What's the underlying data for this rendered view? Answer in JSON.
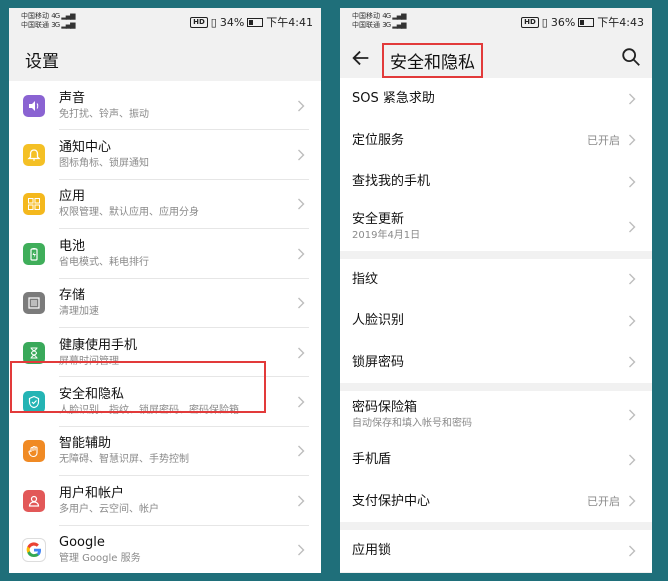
{
  "left": {
    "status": {
      "carrier1": "中国移动",
      "carrier2": "中国联通",
      "net1": "4G",
      "net2": "3G",
      "hd": "HD",
      "battery": "34%",
      "time": "下午4:41"
    },
    "title": "设置",
    "items": [
      {
        "title": "声音",
        "sub": "免打扰、铃声、振动",
        "icon": "sound-icon",
        "color": "#8a63d2"
      },
      {
        "title": "通知中心",
        "sub": "图标角标、锁屏通知",
        "icon": "bell-icon",
        "color": "#f4c025"
      },
      {
        "title": "应用",
        "sub": "权限管理、默认应用、应用分身",
        "icon": "apps-grid-icon",
        "color": "#f4b81d"
      },
      {
        "title": "电池",
        "sub": "省电模式、耗电排行",
        "icon": "battery-icon",
        "color": "#3fae5a"
      },
      {
        "title": "存储",
        "sub": "清理加速",
        "icon": "storage-icon",
        "color": "#7b7b7b"
      },
      {
        "title": "健康使用手机",
        "sub": "屏幕时间管理",
        "icon": "hourglass-icon",
        "color": "#39a95a"
      },
      {
        "title": "安全和隐私",
        "sub": "人脸识别、指纹、锁屏密码、密码保险箱",
        "icon": "shield-icon",
        "color": "#24b4b4"
      },
      {
        "title": "智能辅助",
        "sub": "无障碍、智慧识屏、手势控制",
        "icon": "hand-icon",
        "color": "#f08a24"
      },
      {
        "title": "用户和帐户",
        "sub": "多用户、云空间、帐户",
        "icon": "user-icon",
        "color": "#e25858"
      },
      {
        "title": "Google",
        "sub": "管理 Google 服务",
        "icon": "google-icon",
        "color": "#ffffff"
      }
    ]
  },
  "right": {
    "status": {
      "carrier1": "中国移动",
      "carrier2": "中国联通",
      "net1": "4G",
      "net2": "3G",
      "hd": "HD",
      "battery": "36%",
      "time": "下午4:43"
    },
    "title": "安全和隐私",
    "groups": [
      [
        {
          "title": "SOS 紧急求助",
          "sub": "",
          "value": ""
        },
        {
          "title": "定位服务",
          "sub": "",
          "value": "已开启"
        },
        {
          "title": "查找我的手机",
          "sub": "",
          "value": ""
        },
        {
          "title": "安全更新",
          "sub": "2019年4月1日",
          "value": ""
        }
      ],
      [
        {
          "title": "指纹",
          "sub": "",
          "value": ""
        },
        {
          "title": "人脸识别",
          "sub": "",
          "value": ""
        },
        {
          "title": "锁屏密码",
          "sub": "",
          "value": ""
        }
      ],
      [
        {
          "title": "密码保险箱",
          "sub": "自动保存和填入帐号和密码",
          "value": ""
        },
        {
          "title": "手机盾",
          "sub": "",
          "value": ""
        },
        {
          "title": "支付保护中心",
          "sub": "",
          "value": "已开启"
        }
      ],
      [
        {
          "title": "应用锁",
          "sub": "",
          "value": ""
        }
      ]
    ]
  },
  "colors": {
    "background": "#1f6f7a",
    "highlight": "#e23a3a"
  }
}
